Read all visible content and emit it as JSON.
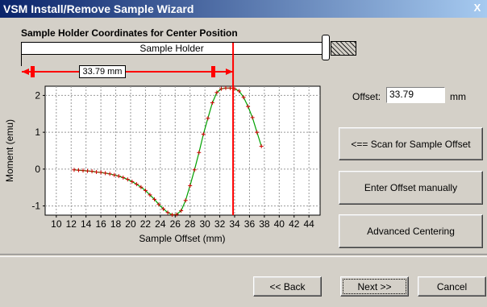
{
  "window": {
    "title": "VSM Install/Remove Sample Wizard",
    "close_glyph": "X"
  },
  "section_title": "Sample Holder Coordinates for Center Position",
  "holder": {
    "label": "Sample Holder",
    "dimension_value": "33.79 mm"
  },
  "offset": {
    "label": "Offset:",
    "value": "33.79",
    "unit": "mm"
  },
  "buttons": {
    "scan": "<== Scan for Sample Offset",
    "manual": "Enter Offset manually",
    "advanced": "Advanced Centering",
    "back": "<< Back",
    "next": "Next >>",
    "cancel": "Cancel"
  },
  "colors": {
    "curve": "#00a000",
    "points": "#d00000",
    "marker": "#ff0000",
    "plot_bg": "#ffffff"
  },
  "chart_data": {
    "type": "line",
    "xlabel": "Sample Offset (mm)",
    "ylabel": "Moment (emu)",
    "xlim": [
      8.5,
      45.5
    ],
    "ylim": [
      -1.25,
      2.25
    ],
    "x_ticks": [
      10,
      12,
      14,
      16,
      18,
      20,
      22,
      24,
      26,
      28,
      30,
      32,
      34,
      36,
      38,
      40,
      42,
      44
    ],
    "y_ticks": [
      -1,
      0,
      1,
      2
    ],
    "grid": true,
    "marker_x": 33.79,
    "series": [
      {
        "x": [
          12.4,
          13.0,
          13.6,
          14.2,
          14.8,
          15.4,
          16.0,
          16.6,
          17.2,
          17.8,
          18.4,
          19.0,
          19.6,
          20.2,
          20.8,
          21.4,
          22.0,
          22.6,
          23.2,
          23.8,
          24.4,
          25.0,
          25.6,
          26.2,
          26.8,
          27.4,
          28.0,
          28.6,
          29.2,
          29.8,
          30.4,
          31.0,
          31.6,
          32.2,
          32.8,
          33.4,
          34.0,
          34.6,
          35.2,
          35.8,
          36.4,
          37.0,
          37.6
        ],
        "y": [
          -0.02,
          -0.03,
          -0.04,
          -0.05,
          -0.06,
          -0.08,
          -0.09,
          -0.11,
          -0.13,
          -0.16,
          -0.19,
          -0.23,
          -0.28,
          -0.34,
          -0.41,
          -0.49,
          -0.58,
          -0.7,
          -0.82,
          -0.96,
          -1.08,
          -1.18,
          -1.24,
          -1.23,
          -1.13,
          -0.85,
          -0.45,
          -0.02,
          0.45,
          0.95,
          1.38,
          1.8,
          2.08,
          2.18,
          2.2,
          2.2,
          2.18,
          2.12,
          1.95,
          1.7,
          1.4,
          1.0,
          0.62
        ]
      }
    ]
  }
}
